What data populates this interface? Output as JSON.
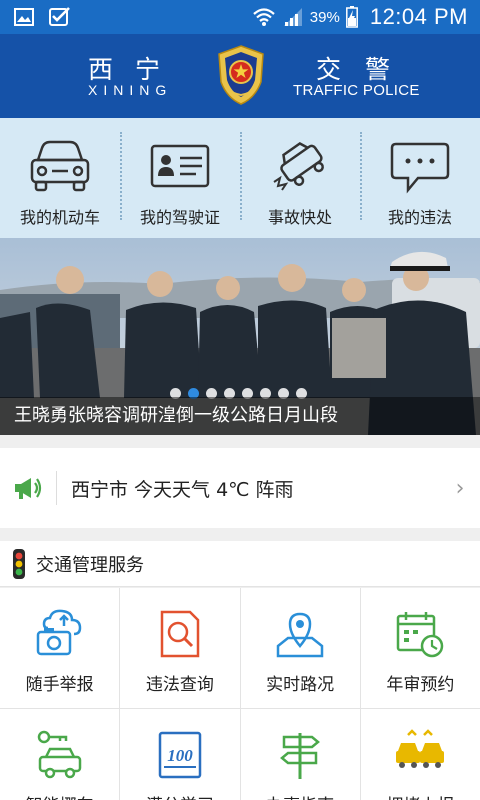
{
  "status_bar": {
    "battery_percent": "39%",
    "time": "12:04 PM"
  },
  "header": {
    "city_cn": "西宁",
    "city_en": "XINING",
    "dept_cn": "交警",
    "dept_en": "TRAFFIC POLICE"
  },
  "quick_actions": [
    {
      "label": "我的机动车",
      "icon": "car-icon"
    },
    {
      "label": "我的驾驶证",
      "icon": "license-card-icon"
    },
    {
      "label": "事故快处",
      "icon": "car-crash-icon"
    },
    {
      "label": "我的违法",
      "icon": "chat-bubble-icon"
    }
  ],
  "banner": {
    "caption": "王晓勇张晓容调研湟倒一级公路日月山段",
    "slide_count": 8,
    "active_slide": 2
  },
  "weather": {
    "text": "西宁市   今天天气  4℃ 阵雨"
  },
  "services": {
    "title": "交通管理服务",
    "items": [
      {
        "label": "随手举报",
        "icon": "camera-upload-icon",
        "color": "#2a8fd8"
      },
      {
        "label": "违法查询",
        "icon": "document-search-icon",
        "color": "#e2522f"
      },
      {
        "label": "实时路况",
        "icon": "map-pin-icon",
        "color": "#2a8fd8"
      },
      {
        "label": "年审预约",
        "icon": "calendar-clock-icon",
        "color": "#4aa84a"
      },
      {
        "label": "智能挪车",
        "icon": "car-key-icon",
        "color": "#4aa84a"
      },
      {
        "label": "满分学习",
        "icon": "score-100-icon",
        "color": "#2a6fc0"
      },
      {
        "label": "办事指南",
        "icon": "signpost-icon",
        "color": "#4aa84a"
      },
      {
        "label": "拥堵上报",
        "icon": "traffic-jam-icon",
        "color": "#e8b800"
      }
    ]
  }
}
